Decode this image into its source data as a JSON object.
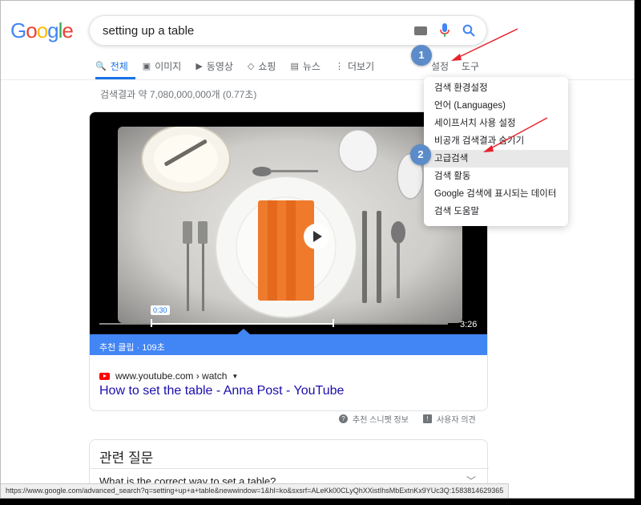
{
  "header": {
    "logo": [
      "G",
      "o",
      "o",
      "g",
      "l",
      "e"
    ],
    "logo_colors": [
      "#4285f4",
      "#ea4335",
      "#fbbc05",
      "#4285f4",
      "#34a853",
      "#ea4335"
    ],
    "search_query": "setting up a table"
  },
  "tabs": [
    {
      "icon": "search-icon",
      "glyph": "🔍",
      "label": "전체"
    },
    {
      "icon": "image-icon",
      "glyph": "▣",
      "label": "이미지"
    },
    {
      "icon": "video-icon",
      "glyph": "▶",
      "label": "동영상"
    },
    {
      "icon": "tag-icon",
      "glyph": "◇",
      "label": "쇼핑"
    },
    {
      "icon": "news-icon",
      "glyph": "▤",
      "label": "뉴스"
    },
    {
      "icon": "more-icon",
      "glyph": "⋮",
      "label": "더보기"
    }
  ],
  "tools": {
    "settings_label": "설정",
    "tools_label": "도구"
  },
  "result_stats": "검색결과 약 7,080,000,000개 (0.77초)",
  "video": {
    "time_start": "0:30",
    "duration": "3:26",
    "clip_label": "추천 클립 · 109초",
    "source": "www.youtube.com › watch",
    "title": "How to set the table - Anna Post - YouTube"
  },
  "feedback": {
    "snippet_info": "추천 스니펫 정보",
    "user_feedback": "사용자 의견"
  },
  "related_questions": {
    "title": "관련 질문",
    "questions": [
      "What is the correct way to set a table?"
    ]
  },
  "status_url": "https://www.google.com/advanced_search?q=setting+up+a+table&newwindow=1&hl=ko&sxsrf=ALeKk00CLyQhXXistIhsMbExtnKx9YUc3Q:1583814629365",
  "settings_menu": [
    "검색 환경설정",
    "언어 (Languages)",
    "세이프서치 사용 설정",
    "비공개 검색결과 숨기기",
    "고급검색",
    "검색 활동",
    "Google 검색에 표시되는 데이터",
    "검색 도움말"
  ],
  "annotations": {
    "badge1": "1",
    "badge2": "2",
    "color": "#e8212b"
  }
}
